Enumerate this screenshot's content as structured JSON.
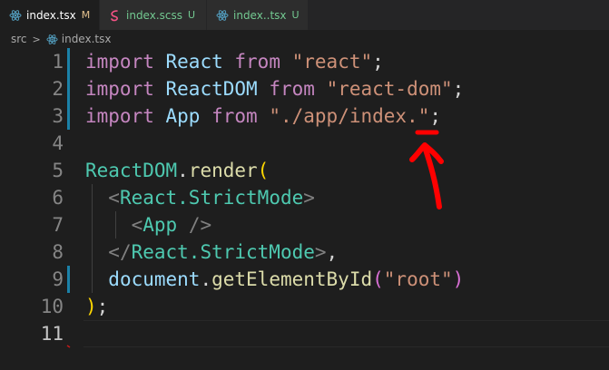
{
  "tabs": [
    {
      "label": "index.tsx",
      "flag": "M",
      "icon": "react-icon",
      "active": true
    },
    {
      "label": "index.scss",
      "flag": "U",
      "icon": "sass-icon",
      "active": false
    },
    {
      "label": "index..tsx",
      "flag": "U",
      "icon": "react-icon",
      "active": false
    }
  ],
  "breadcrumb": {
    "folder": "src",
    "separator": ">",
    "file": "index.tsx"
  },
  "editor": {
    "line_numbers": [
      "1",
      "2",
      "3",
      "4",
      "5",
      "6",
      "7",
      "8",
      "9",
      "10",
      "11"
    ],
    "lines": {
      "l1": {
        "kw1": "import",
        "id": "React",
        "kw2": "from",
        "str": "\"react\"",
        "end": ";"
      },
      "l2": {
        "kw1": "import",
        "id": "ReactDOM",
        "kw2": "from",
        "str": "\"react-dom\"",
        "end": ";"
      },
      "l3": {
        "kw1": "import",
        "id": "App",
        "kw2": "from",
        "str": "\"./app/index.\"",
        "end": ";"
      },
      "l5": {
        "obj": "ReactDOM",
        "dot": ".",
        "fn": "render",
        "open": "("
      },
      "l6": {
        "lt": "<",
        "tag": "React.StrictMode",
        "gt": ">"
      },
      "l7": {
        "lt": "<",
        "tag": "App",
        "close": " />"
      },
      "l8": {
        "lt": "</",
        "tag": "React.StrictMode",
        "gt": ">",
        "comma": ","
      },
      "l9": {
        "obj": "document",
        "dot": ".",
        "fn": "getElementById",
        "open": "(",
        "str": "\"root\"",
        "close": ")"
      },
      "l10": {
        "close": ")",
        "end": ";"
      }
    }
  },
  "colors": {
    "annotation": "#ff0000",
    "modified_gutter": "#1b81a8"
  }
}
